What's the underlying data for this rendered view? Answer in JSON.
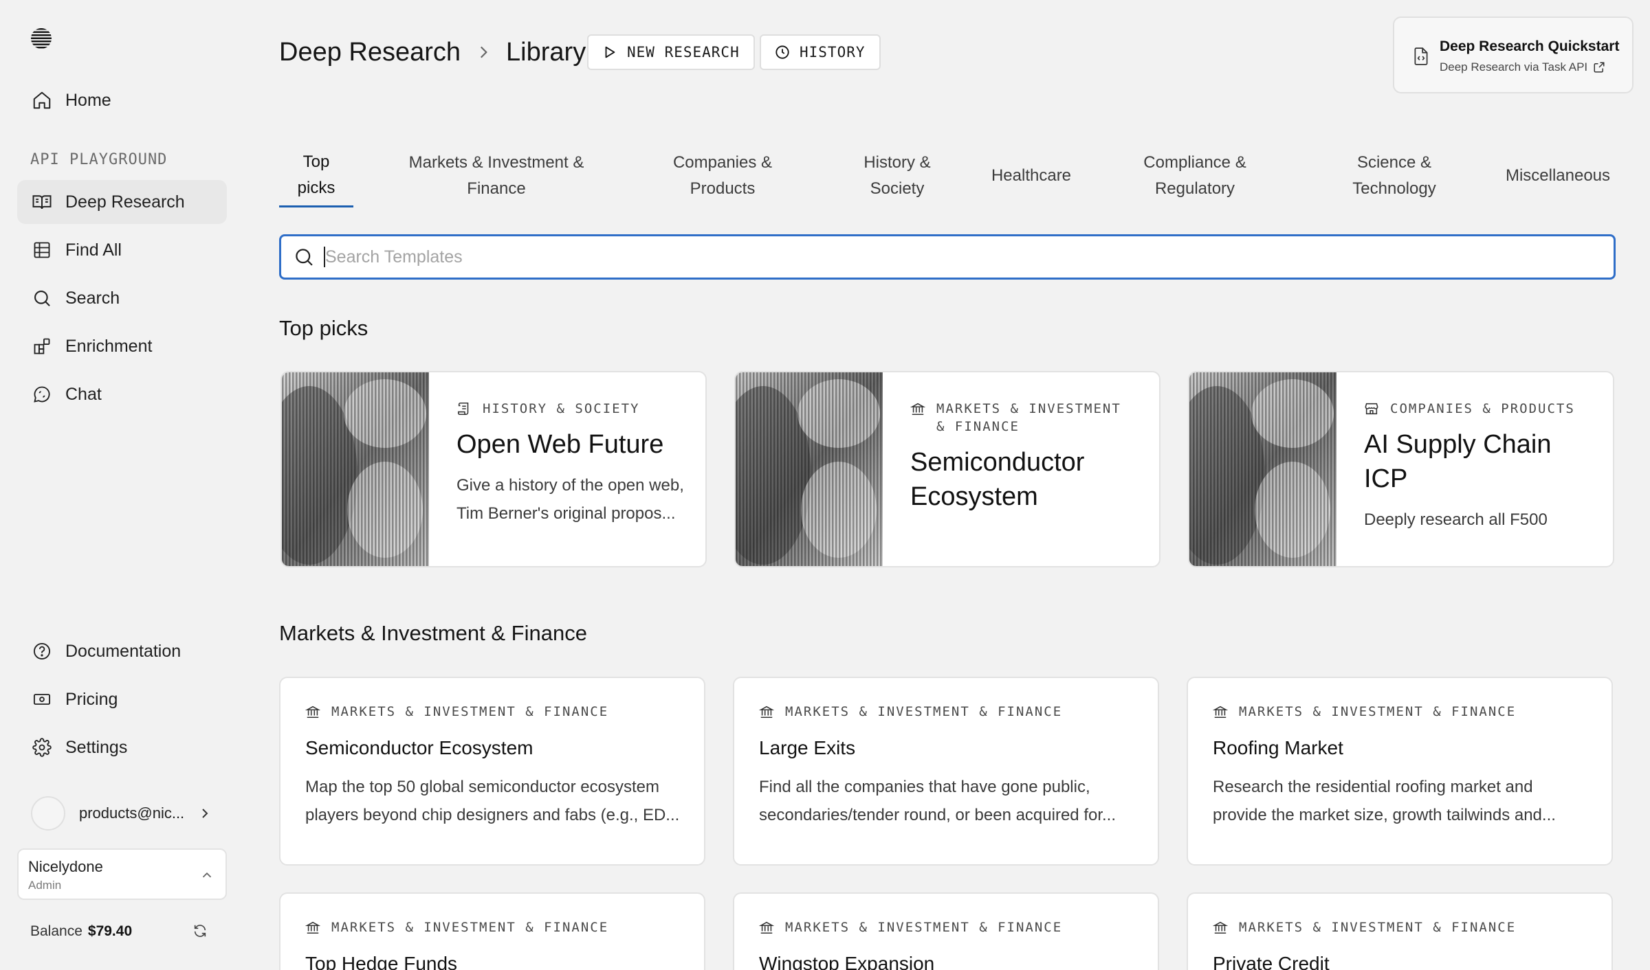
{
  "sidebar": {
    "logo": "parallel-logo-icon",
    "home": "Home",
    "section_label": "API PLAYGROUND",
    "items": [
      {
        "label": "Deep Research",
        "icon": "book-open-icon"
      },
      {
        "label": "Find All",
        "icon": "grid-icon"
      },
      {
        "label": "Search",
        "icon": "search-icon"
      },
      {
        "label": "Enrichment",
        "icon": "blocks-icon"
      },
      {
        "label": "Chat",
        "icon": "chat-icon"
      }
    ],
    "bottom_items": [
      {
        "label": "Documentation",
        "icon": "help-circle-icon"
      },
      {
        "label": "Pricing",
        "icon": "banknote-icon"
      },
      {
        "label": "Settings",
        "icon": "gear-icon"
      }
    ],
    "user_email": "products@nic...",
    "org_name": "Nicelydone",
    "org_role": "Admin",
    "balance_label": "Balance",
    "balance_value": "$79.40"
  },
  "header": {
    "breadcrumb": [
      "Deep Research",
      "Library"
    ],
    "new_research": "NEW RESEARCH",
    "history": "HISTORY",
    "quickstart_title": "Deep Research Quickstart",
    "quickstart_sub": "Deep Research via Task API"
  },
  "tabs": [
    {
      "line1": "Top",
      "line2": "picks"
    },
    {
      "line1": "Markets & Investment &",
      "line2": "Finance"
    },
    {
      "line1": "Companies &",
      "line2": "Products"
    },
    {
      "line1": "History &",
      "line2": "Society"
    },
    {
      "line1": "Healthcare",
      "line2": ""
    },
    {
      "line1": "Compliance &",
      "line2": "Regulatory"
    },
    {
      "line1": "Science &",
      "line2": "Technology"
    },
    {
      "line1": "Miscellaneous",
      "line2": ""
    }
  ],
  "search": {
    "placeholder": "Search Templates"
  },
  "sections": {
    "top_picks": "Top picks",
    "markets": "Markets & Investment & Finance"
  },
  "top_picks": [
    {
      "category": "HISTORY & SOCIETY",
      "cat_icon": "scroll-icon",
      "title": "Open Web Future",
      "desc": "Give a history of the open web, Tim Berner's original propos..."
    },
    {
      "category": "MARKETS & INVESTMENT & FINANCE",
      "cat_icon": "bank-icon",
      "title": "Semiconductor Ecosystem",
      "desc": ""
    },
    {
      "category": "COMPANIES & PRODUCTS",
      "cat_icon": "store-icon",
      "title": "AI Supply Chain ICP",
      "desc": "Deeply research all F500"
    }
  ],
  "markets_templates": [
    {
      "category": "MARKETS & INVESTMENT & FINANCE",
      "title": "Semiconductor Ecosystem",
      "desc": "Map the top 50 global semiconductor ecosystem players beyond chip designers and fabs (e.g., ED..."
    },
    {
      "category": "MARKETS & INVESTMENT & FINANCE",
      "title": "Large Exits",
      "desc": "Find all the companies that have gone public, secondaries/tender round, or been acquired for..."
    },
    {
      "category": "MARKETS & INVESTMENT & FINANCE",
      "title": "Roofing Market",
      "desc": "Research the residential roofing market and provide the market size, growth tailwinds and..."
    },
    {
      "category": "MARKETS & INVESTMENT & FINANCE",
      "title": "Top Hedge Funds",
      "desc": ""
    },
    {
      "category": "MARKETS & INVESTMENT & FINANCE",
      "title": "Wingstop Expansion",
      "desc": ""
    },
    {
      "category": "MARKETS & INVESTMENT & FINANCE",
      "title": "Private Credit",
      "desc": ""
    }
  ],
  "colors": {
    "accent": "#2f6ec8",
    "tab_underline": "#1c5fb0",
    "background": "#f2f2f2"
  }
}
